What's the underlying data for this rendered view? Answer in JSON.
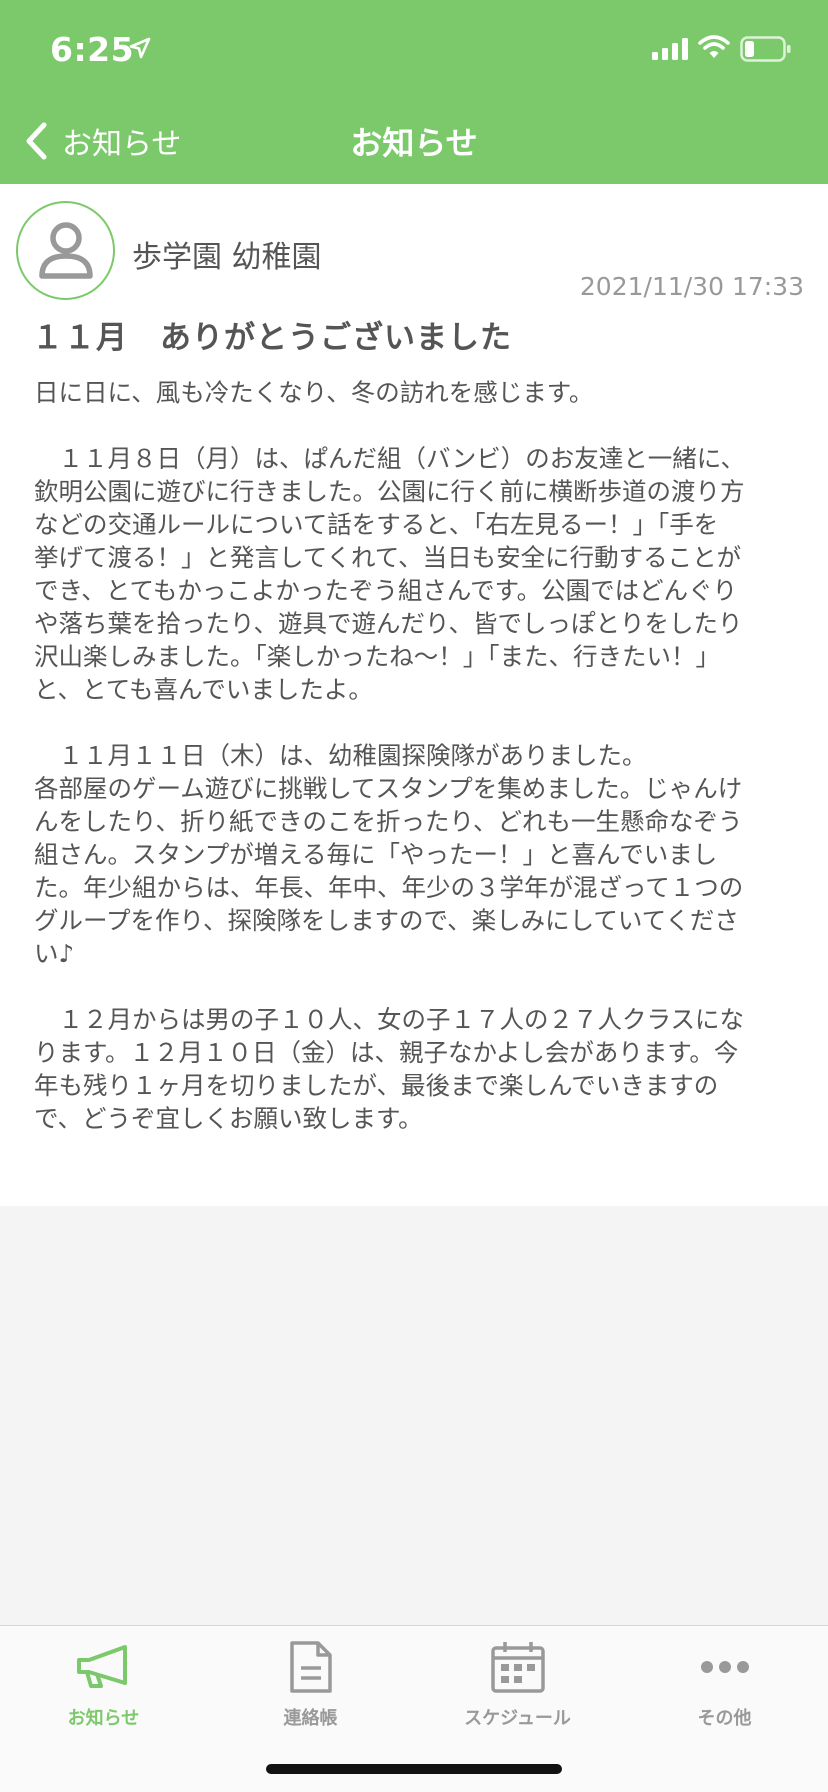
{
  "status_bar": {
    "time": "6:25"
  },
  "nav": {
    "back_label": "お知らせ",
    "title": "お知らせ"
  },
  "post": {
    "sender": "歩学園 幼稚園",
    "timestamp": "2021/11/30 17:33",
    "title": "１１月　ありがとうございました",
    "body_lines": [
      "日に日に、風も冷たくなり、冬の訪れを感じます。",
      "",
      "　１１月８日（月）は、ぱんだ組（バンビ）のお友達と一緒に、",
      "欽明公園に遊びに行きました。公園に行く前に横断歩道の渡り方",
      "などの交通ルールについて話をすると、「右左見るー！」「手を",
      "挙げて渡る！」と発言してくれて、当日も安全に行動することが",
      "でき、とてもかっこよかったぞう組さんです。公園ではどんぐり",
      "や落ち葉を拾ったり、遊具で遊んだり、皆でしっぽとりをしたり",
      "沢山楽しみました。「楽しかったね～！」「また、行きたい！」",
      "と、とても喜んでいましたよ。",
      "",
      "　１１月１１日（木）は、幼稚園探険隊がありました。",
      "各部屋のゲーム遊びに挑戦してスタンプを集めました。じゃんけ",
      "んをしたり、折り紙できのこを折ったり、どれも一生懸命なぞう",
      "組さん。スタンプが増える毎に「やったー！」と喜んでいまし",
      "た。年少組からは、年長、年中、年少の３学年が混ざって１つの",
      "グループを作り、探険隊をしますので、楽しみにしていてくださ",
      "い♪",
      "",
      "　１２月からは男の子１０人、女の子１７人の２７人クラスにな",
      "ります。１２月１０日（金）は、親子なかよし会があります。今",
      "年も残り１ヶ月を切りましたが、最後まで楽しんでいきますの",
      "で、どうぞ宜しくお願い致します。"
    ]
  },
  "tabs": [
    {
      "label": "お知らせ",
      "icon": "megaphone-icon",
      "active": true
    },
    {
      "label": "連絡帳",
      "icon": "document-icon",
      "active": false
    },
    {
      "label": "スケジュール",
      "icon": "calendar-icon",
      "active": false
    },
    {
      "label": "その他",
      "icon": "more-icon",
      "active": false
    }
  ],
  "colors": {
    "brand": "#7cc96b",
    "tab_inactive": "#999999"
  }
}
